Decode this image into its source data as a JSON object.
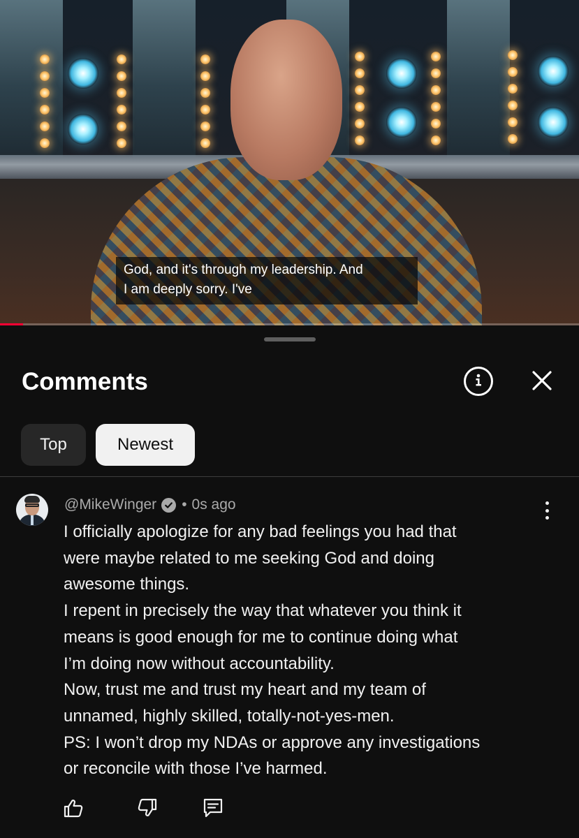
{
  "video": {
    "caption_lines": [
      "God, and it's through my leadership. And",
      "I am deeply sorry. I've"
    ],
    "progress_fraction": 0.04,
    "progress_color": "#ff0033"
  },
  "comments_panel": {
    "title": "Comments",
    "info_icon": "info-circle-icon",
    "close_icon": "close-icon",
    "sort_chips": [
      {
        "label": "Top",
        "selected": false
      },
      {
        "label": "Newest",
        "selected": true
      }
    ]
  },
  "comment": {
    "author": "@MikeWinger",
    "verified": true,
    "separator": "•",
    "time": "0s ago",
    "text_lines": [
      "I officially apologize for any bad feelings you had that",
      "were maybe related to me seeking God and doing",
      "awesome things.",
      "I repent in precisely the way that whatever you think it",
      "means is good enough for me to continue doing what",
      "I’m doing now without accountability.",
      "Now, trust me and trust my heart and my team of",
      "unnamed, highly skilled, totally-not-yes-men.",
      "PS: I won’t drop my NDAs or approve any investigations",
      "or reconcile with those I’ve harmed."
    ],
    "actions": [
      "thumbs-up-icon",
      "thumbs-down-icon",
      "reply-icon"
    ]
  }
}
